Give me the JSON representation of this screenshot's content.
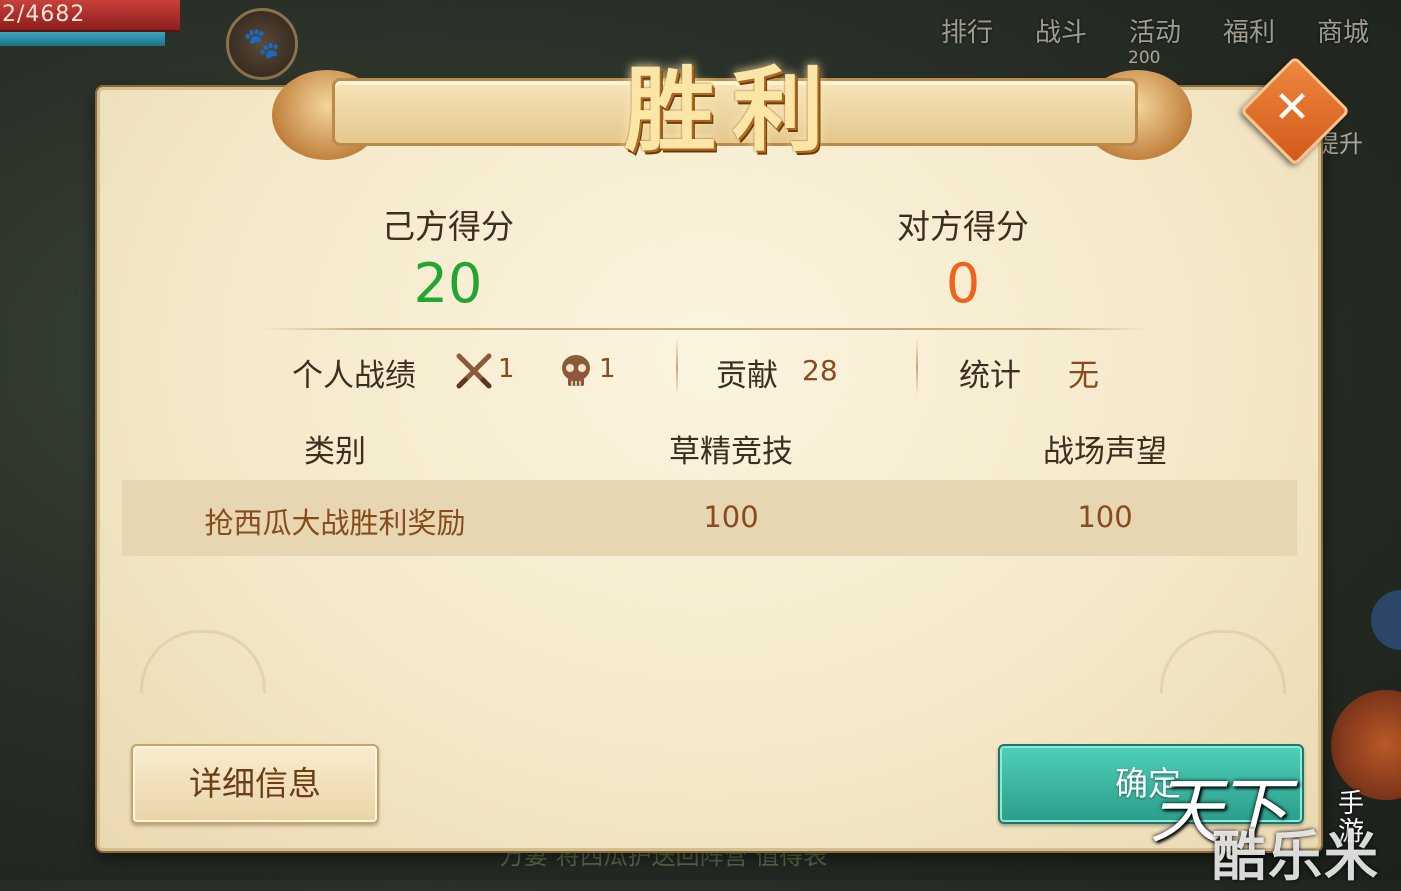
{
  "hud": {
    "hp_text": "2/4682",
    "paw_icon": "paw-icon",
    "menu": [
      "排行",
      "战斗",
      "活动",
      "福利",
      "商城"
    ],
    "activity_badge": "200",
    "upgrade_label": "提升",
    "chat_text": "万妻  将西瓜护送回阵营  值得表"
  },
  "dialog": {
    "title": "胜利",
    "close_icon": "close-icon",
    "ally_score_label": "己方得分",
    "ally_score": "20",
    "enemy_score_label": "对方得分",
    "enemy_score": "0",
    "personal_label": "个人战绩",
    "kills": "1",
    "deaths": "1",
    "contribution_label": "贡献",
    "contribution": "28",
    "stats_label": "统计",
    "stats_value": "无",
    "table": {
      "headers": [
        "类别",
        "草精竞技",
        "战场声望"
      ],
      "rows": [
        [
          "抢西瓜大战胜利奖励",
          "100",
          "100"
        ]
      ]
    },
    "detail_button": "详细信息",
    "confirm_button": "确定"
  },
  "watermark": {
    "logo": "天下",
    "sub": "手游",
    "site": "酷乐米"
  },
  "colors": {
    "ally_score": "#22a531",
    "enemy_score": "#f0621e",
    "reward_text": "#8a4b1c",
    "confirm_button": "#2fae98"
  }
}
